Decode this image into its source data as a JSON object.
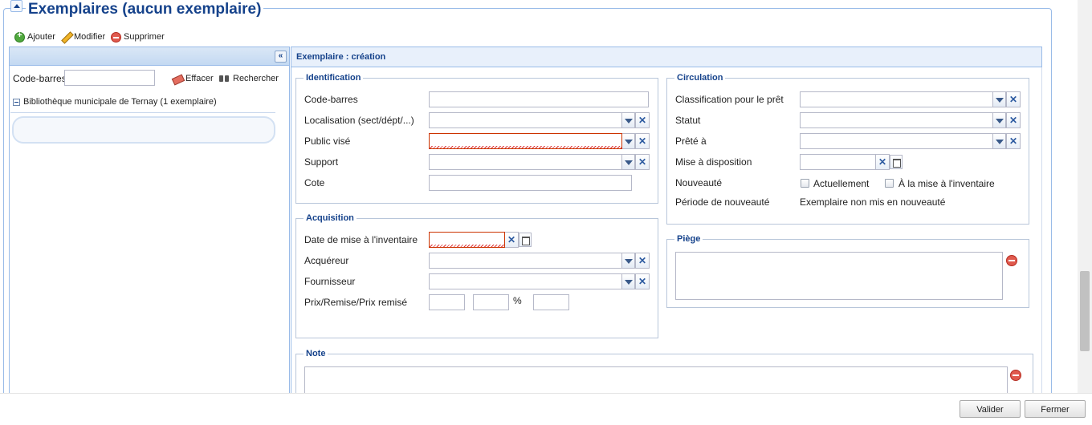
{
  "header": {
    "title": "Exemplaires (aucun exemplaire)"
  },
  "toolbar": {
    "add_label": "Ajouter",
    "edit_label": "Modifier",
    "delete_label": "Supprimer"
  },
  "left": {
    "barcode_label": "Code-barres",
    "barcode_value": "",
    "clear_label": "Effacer",
    "search_label": "Rechercher",
    "tree_node": "Bibliothèque municipale de Ternay (1 exemplaire)"
  },
  "form": {
    "title": "Exemplaire : création",
    "identification": {
      "legend": "Identification",
      "barcode": "Code-barres",
      "location": "Localisation (sect/dépt/...)",
      "audience": "Public visé",
      "medium": "Support",
      "shelfmark": "Cote"
    },
    "acquisition": {
      "legend": "Acquisition",
      "inventory_date": "Date de mise à l'inventaire",
      "acquirer": "Acquéreur",
      "supplier": "Fournisseur",
      "price": "Prix/Remise/Prix remisé",
      "percent": "%"
    },
    "circulation": {
      "legend": "Circulation",
      "loan_class": "Classification pour le prêt",
      "status": "Statut",
      "lent_to": "Prêté à",
      "availability": "Mise à disposition",
      "novelty": "Nouveauté",
      "novelty_current": "Actuellement",
      "novelty_inventory": "À la mise à l'inventaire",
      "novelty_period": "Période de nouveauté",
      "novelty_period_value": "Exemplaire non mis en nouveauté"
    },
    "trap": {
      "legend": "Piège"
    },
    "note": {
      "legend": "Note"
    }
  },
  "footer": {
    "validate": "Valider",
    "close": "Fermer"
  },
  "colors": {
    "accent": "#15428b",
    "border": "#99bbe8",
    "invalid": "#cc3300"
  }
}
